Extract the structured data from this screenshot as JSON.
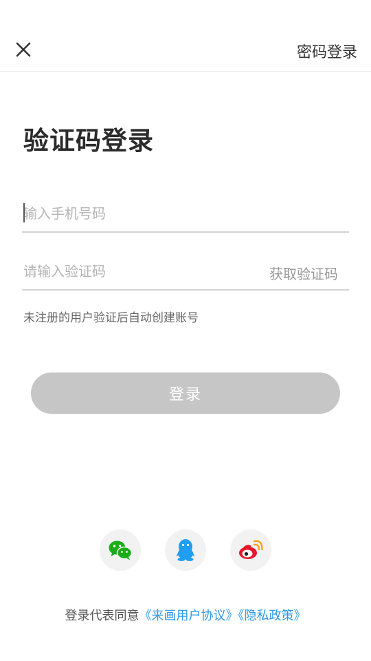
{
  "header": {
    "password_login_label": "密码登录"
  },
  "main": {
    "title": "验证码登录",
    "phone_placeholder": "输入手机号码",
    "code_placeholder": "请输入验证码",
    "get_code_label": "获取验证码",
    "hint": "未注册的用户验证后自动创建账号",
    "login_label": "登录"
  },
  "social": {
    "icons": [
      "wechat-icon",
      "qq-icon",
      "weibo-icon"
    ]
  },
  "agreement": {
    "prefix": "登录代表同意",
    "user_agreement": "《来画用户协议》",
    "privacy_policy": "《隐私政策》"
  },
  "colors": {
    "accent_link": "#2e9ae6",
    "button_disabled": "#c6c6c6",
    "wechat": "#1aad19",
    "qq": "#1e9ff2",
    "weibo": "#e6162d"
  }
}
